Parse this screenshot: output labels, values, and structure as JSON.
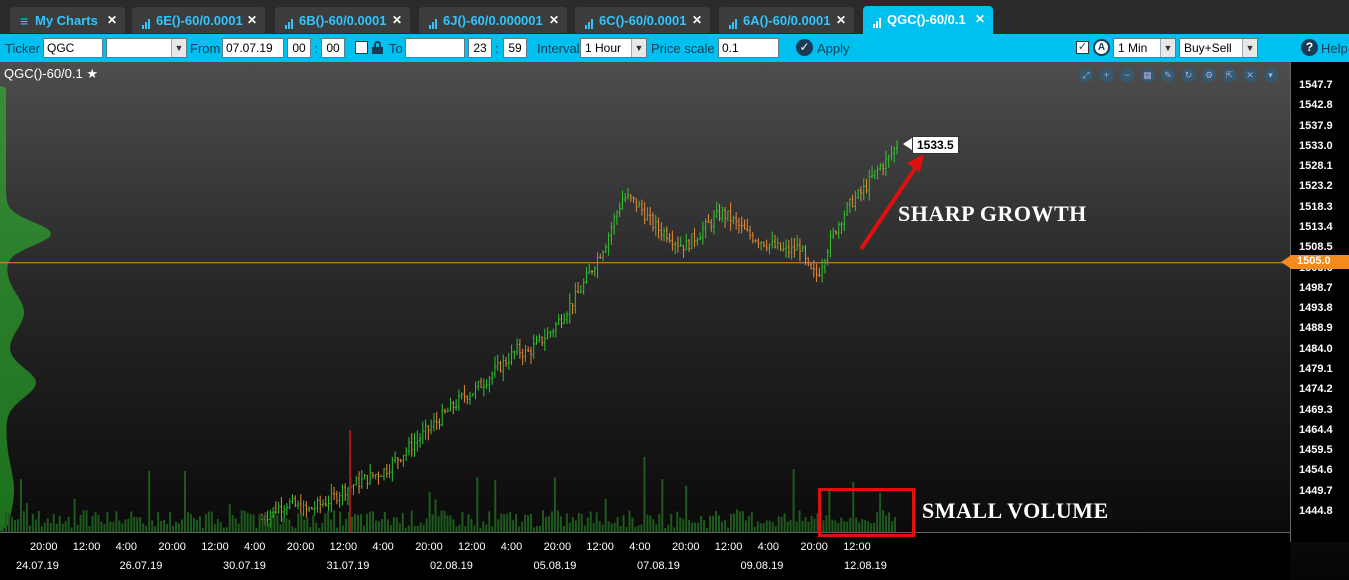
{
  "tabs": [
    {
      "label": "My Charts",
      "icon": "menu-icon"
    },
    {
      "label": "6E()-60/0.0001",
      "icon": "chart-icon"
    },
    {
      "label": "6B()-60/0.0001",
      "icon": "chart-icon"
    },
    {
      "label": "6J()-60/0.000001",
      "icon": "chart-icon"
    },
    {
      "label": "6C()-60/0.0001",
      "icon": "chart-icon"
    },
    {
      "label": "6A()-60/0.0001",
      "icon": "chart-icon"
    },
    {
      "label": "QGC()-60/0.1",
      "icon": "chart-icon",
      "active": true
    }
  ],
  "toolbar": {
    "ticker_label": "Ticker",
    "ticker_value": "QGC",
    "ticker_select": "",
    "from_label": "From",
    "from_date": "07.07.19",
    "from_hour": "00",
    "from_min": "00",
    "to_label": "To",
    "to_date": "",
    "to_hour": "23",
    "to_min": "59",
    "interval_label": "Interval",
    "interval_value": "1 Hour",
    "price_scale_label": "Price scale",
    "price_scale_value": "0.1",
    "apply_label": "Apply",
    "timeframe_value": "1 Min",
    "side_value": "Buy+Sell",
    "help_label": "Help"
  },
  "chart": {
    "title": "QGC()-60/0.1",
    "controls": [
      "zoom-fit-icon",
      "zoom-in-icon",
      "zoom-out-icon",
      "grid-icon",
      "pencil-icon",
      "refresh-icon",
      "settings-icon",
      "expand-icon",
      "close-icon",
      "collapse-icon"
    ],
    "last_price": "1533.5",
    "level_price": "1505.0",
    "annotation_growth": "SHARP GROWTH",
    "annotation_volume": "SMALL VOLUME",
    "colors": {
      "up": "#2ec62e",
      "down": "#e8893a",
      "level": "#f28a1e",
      "volume": "#1e5a1e",
      "profile": "#2ec62e",
      "arrow": "#e01010"
    }
  },
  "chart_data": {
    "type": "candlestick",
    "title": "QGC()-60/0.1",
    "y_ticks": [
      "1547.7",
      "1542.8",
      "1537.9",
      "1533.0",
      "1528.1",
      "1523.2",
      "1518.3",
      "1513.4",
      "1508.5",
      "1503.6",
      "1498.7",
      "1493.8",
      "1488.9",
      "1484.0",
      "1479.1",
      "1474.2",
      "1469.3",
      "1464.4",
      "1459.5",
      "1454.6",
      "1449.7",
      "1444.8"
    ],
    "x_time_labels": [
      "20:00",
      "12:00",
      "4:00",
      "20:00",
      "12:00",
      "4:00",
      "20:00",
      "12:00",
      "4:00",
      "20:00",
      "12:00",
      "4:00",
      "20:00",
      "12:00",
      "4:00",
      "20:00",
      "12:00",
      "4:00",
      "20:00",
      "12:00"
    ],
    "x_date_labels": [
      "24.07.19",
      "26.07.19",
      "30.07.19",
      "31.07.19",
      "02.08.19",
      "05.08.19",
      "07.08.19",
      "09.08.19",
      "12.08.19"
    ],
    "ylim": [
      1441,
      1551
    ],
    "price_path": [
      1443,
      1445,
      1446,
      1447,
      1446,
      1445,
      1446,
      1447,
      1448,
      1450,
      1451,
      1452,
      1453,
      1454,
      1455,
      1457,
      1459,
      1461,
      1463,
      1465,
      1467,
      1469,
      1471,
      1473,
      1474,
      1476,
      1478,
      1480,
      1482,
      1484,
      1483,
      1485,
      1487,
      1489,
      1492,
      1495,
      1498,
      1502,
      1506,
      1510,
      1516,
      1521,
      1520,
      1518,
      1515,
      1513,
      1512,
      1510,
      1509,
      1511,
      1513,
      1515,
      1517,
      1516,
      1514,
      1512,
      1511,
      1510,
      1509,
      1508,
      1508,
      1509,
      1503,
      1502,
      1508,
      1513,
      1517,
      1520,
      1522,
      1525,
      1528,
      1530,
      1533.5
    ],
    "last": 1533.5,
    "level": 1505.0
  }
}
